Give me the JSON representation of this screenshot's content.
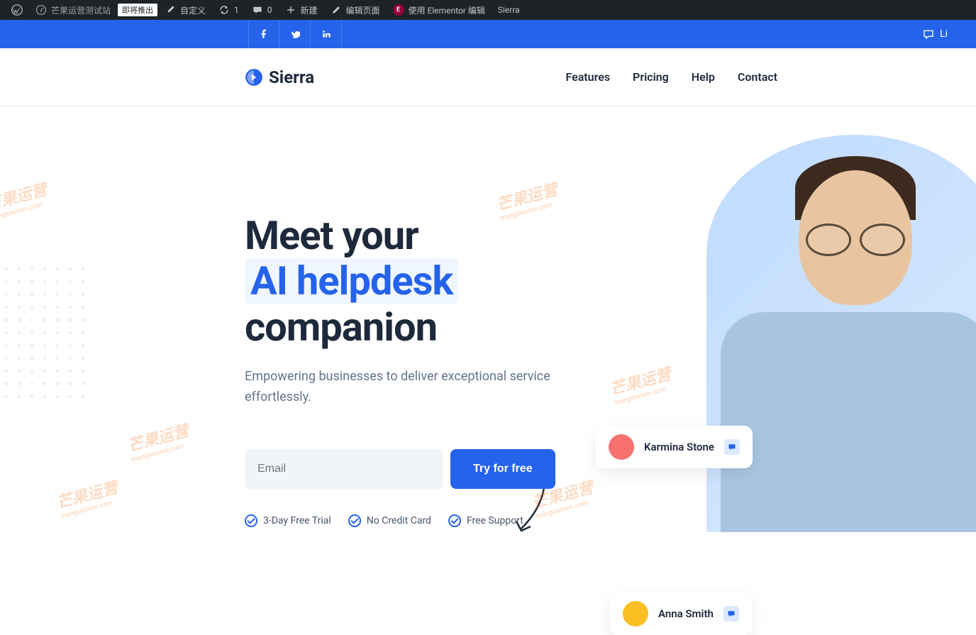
{
  "admin_bar": {
    "site_name": "芒果运营测试站",
    "badge": "即将推出",
    "customize": "自定义",
    "updates": "1",
    "comments": "0",
    "new": "新建",
    "edit_page": "编辑页面",
    "elementor": "使用 Elementor 编辑",
    "user": "Sierra"
  },
  "social_bar": {
    "right_text": "Li"
  },
  "header": {
    "logo": "Sierra",
    "nav": {
      "features": "Features",
      "pricing": "Pricing",
      "help": "Help",
      "contact": "Contact"
    }
  },
  "hero": {
    "title_line1": "Meet your",
    "title_highlight": "AI helpdesk",
    "title_line3": "companion",
    "subtitle": "Empowering businesses to deliver exceptional service effortlessly.",
    "email_placeholder": "Email",
    "cta": "Try for free",
    "features": {
      "f1": "3-Day Free Trial",
      "f2": "No Credit Card",
      "f3": "Free Support"
    }
  },
  "chat_cards": {
    "card1_name": "Karmina Stone",
    "card2_name": "Anna Smith"
  },
  "watermark": {
    "main": "芒果运营",
    "sub": "mangoecom.com"
  }
}
